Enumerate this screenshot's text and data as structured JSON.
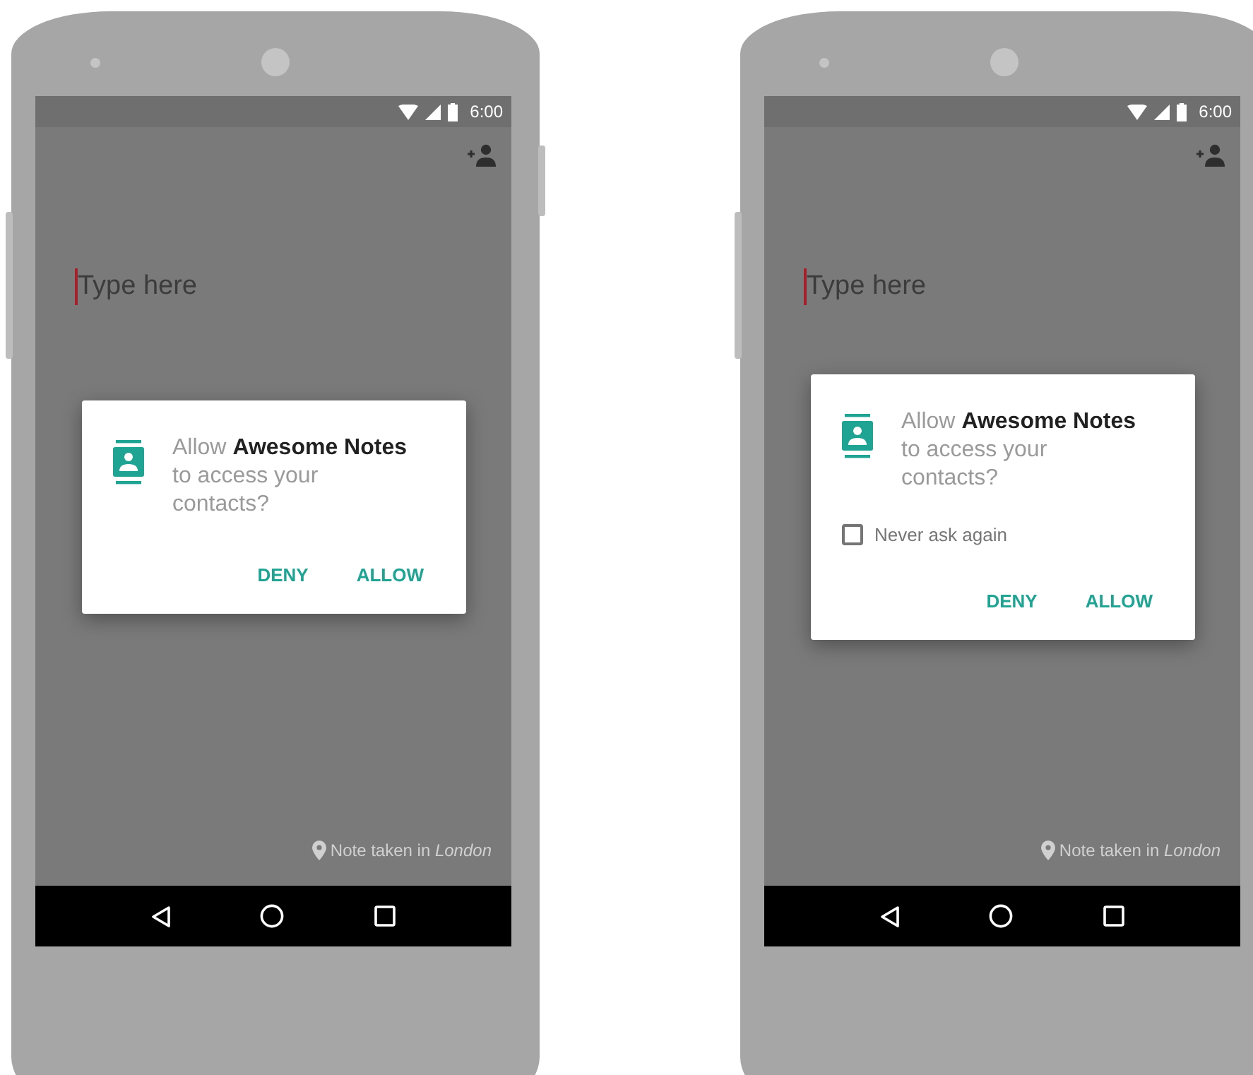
{
  "phones": [
    {
      "status_bar": {
        "time": "6:00"
      },
      "note": {
        "placeholder": "Type here"
      },
      "dialog": {
        "message": "Allow **Awesome Notes** to access your contacts?",
        "buttons": [
          "DENY",
          "ALLOW"
        ]
      },
      "location": "Note taken in *London*"
    },
    {
      "status_bar": {
        "time": "6:00"
      },
      "note": {
        "placeholder": "Type here"
      },
      "dialog": {
        "message": "Allow **Awesome Notes** to access your contacts?",
        "checkbox": {
          "label": "Never ask again",
          "checked": false
        },
        "buttons": [
          "DENY",
          "ALLOW"
        ]
      },
      "location": "Note taken in *London*"
    }
  ]
}
